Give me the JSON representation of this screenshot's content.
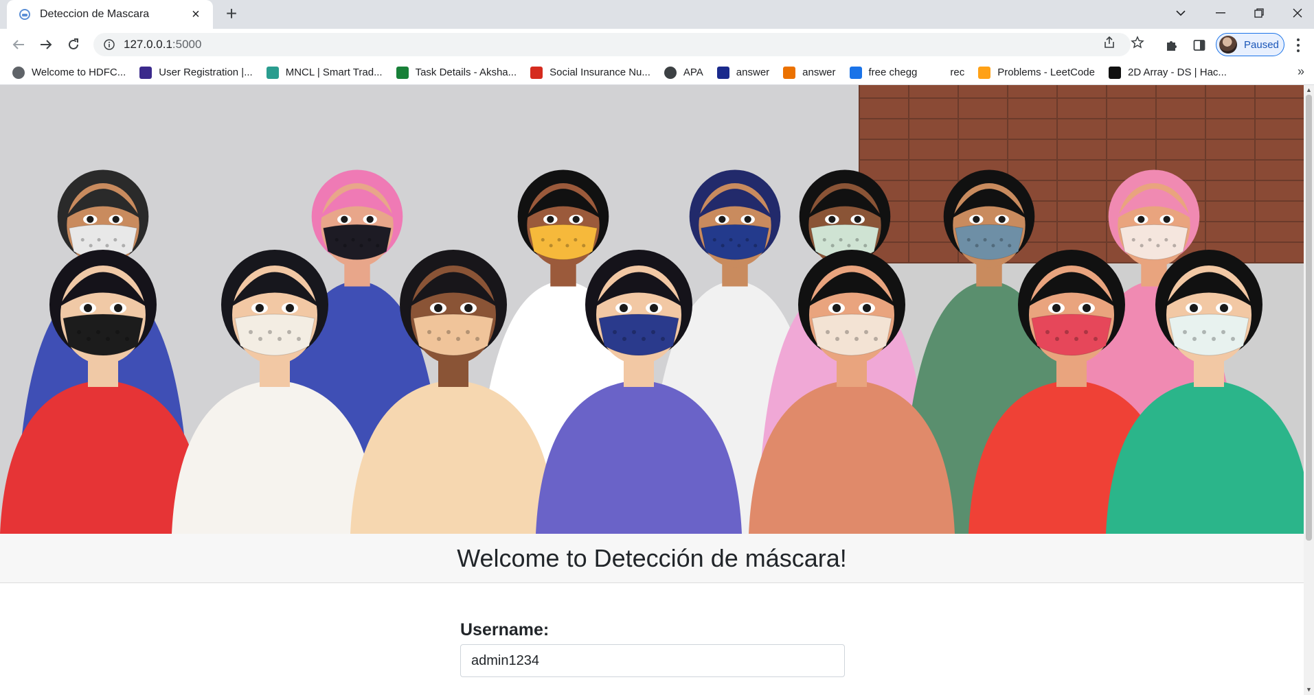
{
  "browser": {
    "tab_title": "Deteccion de Mascara",
    "url_host": "127.0.0.1",
    "url_port": ":5000",
    "profile_label": "Paused",
    "bookmarks": [
      {
        "label": "Welcome to HDFC...",
        "icon": "globe-icon",
        "color": "#5f6368"
      },
      {
        "label": "User Registration |...",
        "icon": "portal-icon",
        "color": "#3b2a8c"
      },
      {
        "label": "MNCL | Smart Trad...",
        "icon": "mncl-icon",
        "color": "#2a9d8f"
      },
      {
        "label": "Task Details - Aksha...",
        "icon": "sheets-plus-icon",
        "color": "#188038"
      },
      {
        "label": "Social Insurance Nu...",
        "icon": "maple-leaf-icon",
        "color": "#d52b1e"
      },
      {
        "label": "APA",
        "icon": "apa-icon",
        "color": "#3c4043"
      },
      {
        "label": "answer",
        "icon": "star-badge-icon",
        "color": "#1a2a8c"
      },
      {
        "label": "answer",
        "icon": "chegg-icon",
        "color": "#eb7100"
      },
      {
        "label": "free chegg",
        "icon": "infinity-icon",
        "color": "#1a73e8"
      },
      {
        "label": "rec",
        "icon": "",
        "color": "#ffffff"
      },
      {
        "label": "Problems - LeetCode",
        "icon": "leetcode-icon",
        "color": "#ffa116"
      },
      {
        "label": "2D Array - DS | Hac...",
        "icon": "hackerrank-icon",
        "color": "#111111"
      }
    ]
  },
  "page": {
    "welcome_title": "Welcome to Detección de máscara!",
    "username_label": "Username:",
    "username_value": "admin1234"
  },
  "hero": {
    "people": [
      {
        "skin": "#c98b5e",
        "clothes": "#3f4fb5",
        "hair": "#2a2a2a",
        "mask": "#e8e8e8"
      },
      {
        "skin": "#f0c9a6",
        "clothes": "#e63436",
        "hair": "#15131a",
        "mask": "#1c1c1c"
      },
      {
        "skin": "#e8a68a",
        "clothes": "#3f4fb5",
        "hair": "#ef7ab5",
        "mask": "#1d1b24"
      },
      {
        "skin": "#f2c8a4",
        "clothes": "#f6f3ee",
        "hair": "#17171d",
        "mask": "#f3ede3"
      },
      {
        "skin": "#8a5436",
        "clothes": "#f6d7b0",
        "hair": "#18161a",
        "mask": "#f0c49a"
      },
      {
        "skin": "#9b5a3b",
        "clothes": "#ffffff",
        "hair": "#111111",
        "mask": "#f6b93b"
      },
      {
        "skin": "#f0b38a",
        "clothes": "#8fd7b8",
        "hair": "#111111",
        "mask": "#dff0e4"
      },
      {
        "skin": "#f2c8a4",
        "clothes": "#6a63c8",
        "hair": "#15131a",
        "mask": "#2a3a8c"
      },
      {
        "skin": "#e9a47e",
        "clothes": "#e08a6a",
        "hair": "#111111",
        "mask": "#f3e3d4"
      },
      {
        "skin": "#c98b5e",
        "clothes": "#f1f1f1",
        "hair": "#222a6b",
        "mask": "#233a8c"
      },
      {
        "skin": "#8a5436",
        "clothes": "#f0a8d6",
        "hair": "#111111",
        "mask": "#cfe3d3"
      },
      {
        "skin": "#e9a47e",
        "clothes": "#ef4136",
        "hair": "#111111",
        "mask": "#e6475a"
      },
      {
        "skin": "#f2c8a4",
        "clothes": "#2bb58a",
        "hair": "#111111",
        "mask": "#e8f2ef"
      },
      {
        "skin": "#c98b5e",
        "clothes": "#5a8f6e",
        "hair": "#111111",
        "mask": "#6e8fa6"
      },
      {
        "skin": "#e9a47e",
        "clothes": "#f08ab2",
        "hair": "#f08ab2",
        "mask": "#f5e6de"
      }
    ]
  }
}
